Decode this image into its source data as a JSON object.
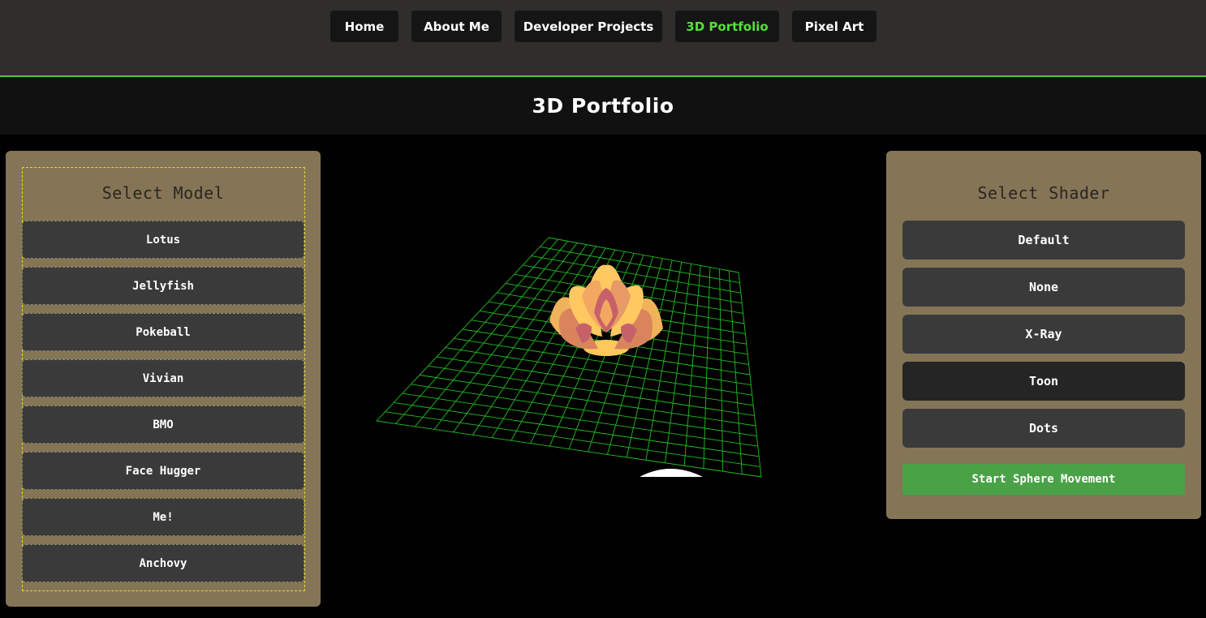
{
  "nav": {
    "items": [
      {
        "label": "Home"
      },
      {
        "label": "About Me"
      },
      {
        "label": "Developer Projects"
      },
      {
        "label": "3D Portfolio"
      },
      {
        "label": "Pixel Art"
      }
    ],
    "active_index": 3
  },
  "page": {
    "title": "3D Portfolio"
  },
  "model_panel": {
    "heading": "Select Model",
    "models": [
      "Lotus",
      "Jellyfish",
      "Pokeball",
      "Vivian",
      "BMO",
      "Face Hugger",
      "Me!",
      "Anchovy"
    ]
  },
  "shader_panel": {
    "heading": "Select Shader",
    "shaders": [
      "Default",
      "None",
      "X-Ray",
      "Toon",
      "Dots"
    ],
    "selected": "Toon",
    "sphere_button": "Start Sphere Movement"
  },
  "viewport": {
    "model_shown": "Lotus",
    "grid_color": "#1fbf1f"
  },
  "colors": {
    "accent_green": "#55e03a",
    "panel": "#857557",
    "button": "#3a3a3b",
    "sphere_button": "#4aa247"
  }
}
